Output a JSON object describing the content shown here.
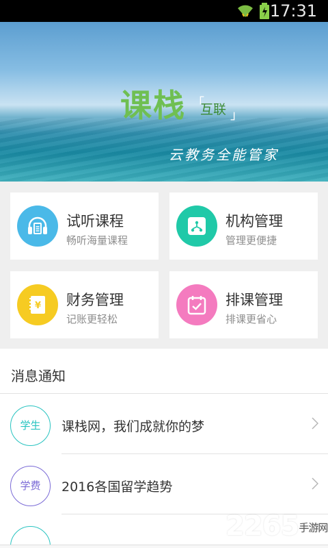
{
  "status_bar": {
    "time": "17:31",
    "wifi_icon": "wifi-icon",
    "battery_icon": "battery-charging-icon"
  },
  "banner": {
    "logo_main": "课栈",
    "logo_sub": "互联",
    "bracket_left": "「",
    "bracket_right": "」",
    "slogan": "云教务全能管家"
  },
  "features": [
    {
      "title": "试听课程",
      "subtitle": "畅听海量课程",
      "icon": "headphones-icon",
      "color": "#4ab9e8"
    },
    {
      "title": "机构管理",
      "subtitle": "管理更便捷",
      "icon": "org-tree-icon",
      "color": "#20c9a8"
    },
    {
      "title": "财务管理",
      "subtitle": "记账更轻松",
      "icon": "ledger-yuan-icon",
      "color": "#f6cb22"
    },
    {
      "title": "排课管理",
      "subtitle": "排课更省心",
      "icon": "calendar-check-icon",
      "color": "#f47bbf"
    }
  ],
  "notice": {
    "header": "消息通知",
    "items": [
      {
        "badge": "学生",
        "badge_color": "#27c3c0",
        "text": "课栈网，我们成就你的梦"
      },
      {
        "badge": "学费",
        "badge_color": "#7a6ad6",
        "text": "2016各国留学趋势"
      }
    ]
  },
  "watermark": {
    "number": "2265",
    "site": "手游网"
  },
  "colors": {
    "accent_green": "#6fbf52"
  }
}
